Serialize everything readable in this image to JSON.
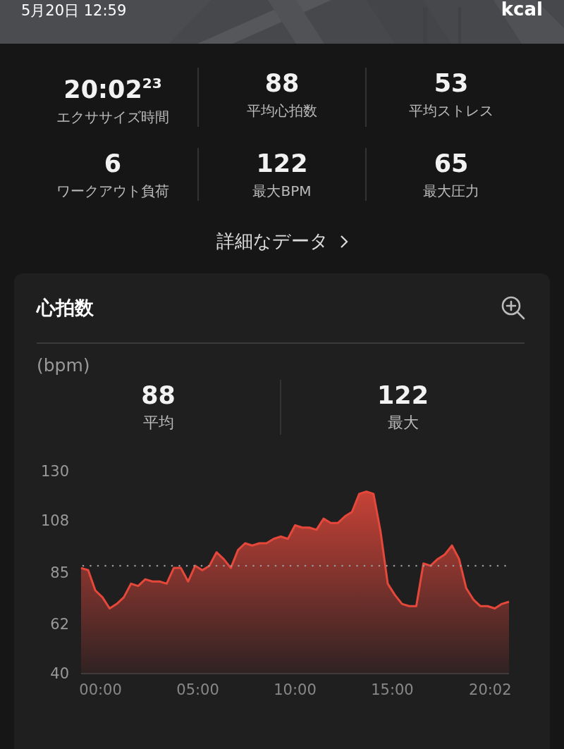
{
  "header": {
    "date": "5月20日 12:59",
    "unit": "kcal"
  },
  "stats": [
    {
      "value": "20:02$^{23}$",
      "label": "エクササイズ時間"
    },
    {
      "value": "88",
      "label": "平均心拍数"
    },
    {
      "value": "53",
      "label": "平均ストレス"
    },
    {
      "value": "6",
      "label": "ワークアウト負荷"
    },
    {
      "value": "122",
      "label": "最大BPM"
    },
    {
      "value": "65",
      "label": "最大圧力"
    }
  ],
  "details_link": "詳細なデータ",
  "heart_rate_card": {
    "title": "心拍数",
    "unit": "(bpm)",
    "summary": [
      {
        "value": "88",
        "label": "平均"
      },
      {
        "value": "122",
        "label": "最大"
      }
    ],
    "chart_data": {
      "type": "area",
      "x": [
        -60,
        -38,
        -16,
        6,
        28,
        50,
        72,
        94,
        116,
        138,
        160,
        182,
        204,
        226,
        248,
        270,
        292,
        314,
        336,
        358,
        380,
        402,
        424,
        446,
        468,
        490,
        512,
        534,
        556,
        578,
        600,
        622,
        644,
        666,
        688,
        710,
        732,
        754,
        776,
        798,
        820,
        842,
        864,
        886,
        908,
        930,
        952,
        974,
        996,
        1018,
        1040,
        1062,
        1084,
        1106,
        1128,
        1150,
        1172,
        1194,
        1216,
        1238,
        1260
      ],
      "series": [
        {
          "color": "#e5483b",
          "values": [
            87,
            86,
            77,
            74,
            69,
            71,
            74,
            80,
            79,
            82,
            81,
            81,
            80,
            87,
            87,
            81,
            88,
            86,
            88,
            94,
            91,
            87,
            95,
            98,
            97,
            98,
            98,
            100,
            101,
            100,
            106,
            105,
            105,
            104,
            109,
            107,
            107,
            110,
            112,
            120,
            121,
            120,
            103,
            80,
            75,
            71,
            70,
            70,
            89,
            88,
            91,
            93,
            97,
            91,
            78,
            73,
            70,
            70,
            69,
            71,
            72
          ]
        }
      ],
      "xlim": [
        -60,
        1260
      ],
      "ylim": [
        40,
        130
      ],
      "xticks": [
        {
          "value": 0,
          "label": "00:00"
        },
        {
          "value": 300,
          "label": "05:00"
        },
        {
          "value": 600,
          "label": "10:00"
        },
        {
          "value": 900,
          "label": "15:00"
        },
        {
          "value": 1202,
          "label": "20:02"
        }
      ],
      "yticks": [
        40,
        62,
        85,
        108,
        130
      ]
    }
  }
}
